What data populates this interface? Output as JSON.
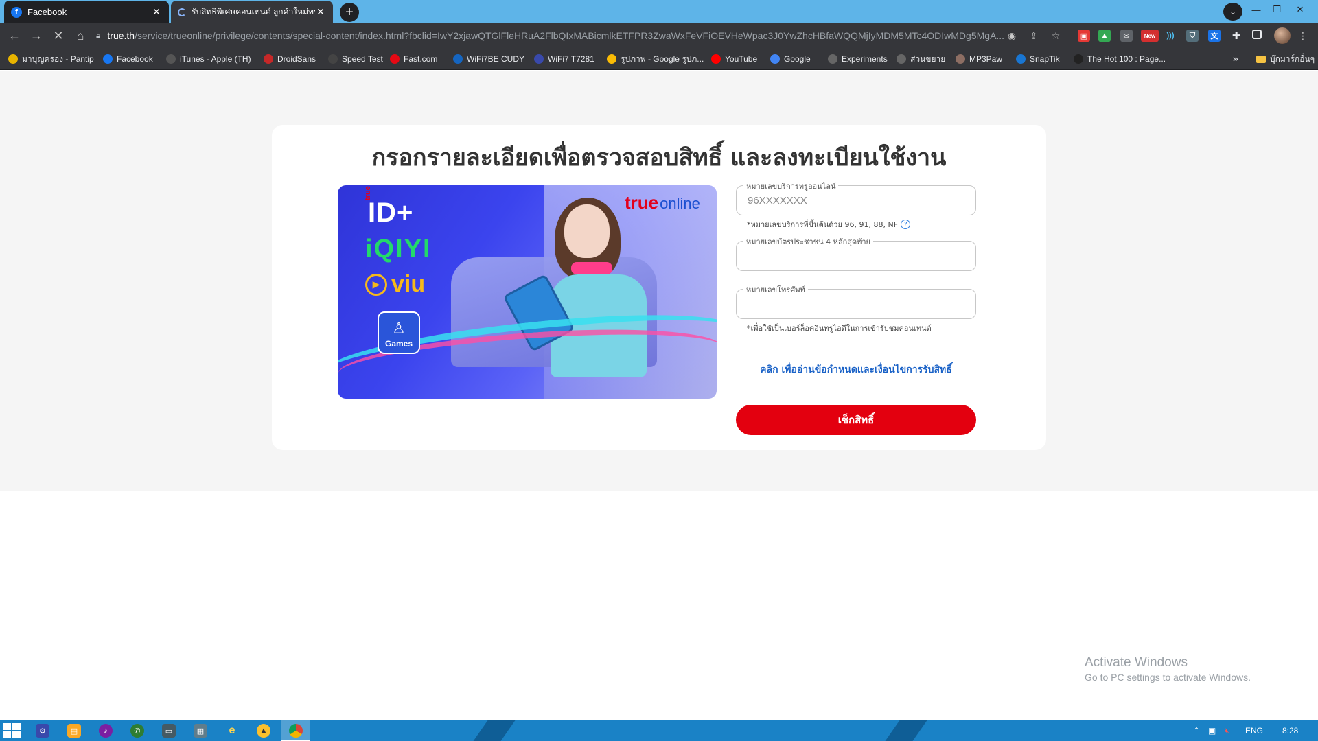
{
  "browser": {
    "tabs": [
      {
        "title": "Facebook",
        "favicon": "facebook-icon",
        "active": true
      },
      {
        "title": "รับสิทธิพิเศษคอนเทนต์ ลูกค้าใหม่ทรูออ",
        "favicon": "loading-icon",
        "active": false
      }
    ],
    "url_host": "true.th",
    "url_path": "/service/trueonline/privilege/contents/special-content/index.html?fbclid=IwY2xjawQTGlFleHRuA2FlbQIxMABicmlkETFPR3ZwaWxFeVFiOEVHeWpac3J0YwZhcHBfaWQQMjIyMDM5MTc4ODIwMDg5MgA...",
    "bookmarks": [
      {
        "label": "มาบุญครอง - Pantip",
        "icon": "pantip-icon",
        "color": "#e8b400"
      },
      {
        "label": "Facebook",
        "icon": "facebook-icon",
        "color": "#1877f2"
      },
      {
        "label": "iTunes - Apple (TH)",
        "icon": "apple-icon",
        "color": "#555555"
      },
      {
        "label": "DroidSans",
        "icon": "droidsans-icon",
        "color": "#c62828"
      },
      {
        "label": "Speed Test",
        "icon": "speedtest-icon",
        "color": "#444444"
      },
      {
        "label": "Fast.com",
        "icon": "fast-icon",
        "color": "#e50914"
      },
      {
        "label": "WiFi7BE CUDY",
        "icon": "cudy-icon",
        "color": "#1565c0"
      },
      {
        "label": "WiFi7 T7281",
        "icon": "wifi-icon",
        "color": "#3949ab"
      },
      {
        "label": "รูปภาพ - Google รูปภ...",
        "icon": "google-photos-icon",
        "color": "#fbbc05"
      },
      {
        "label": "YouTube",
        "icon": "youtube-icon",
        "color": "#ff0000"
      },
      {
        "label": "Google",
        "icon": "google-icon",
        "color": "#4285f4"
      },
      {
        "label": "Experiments",
        "icon": "experiments-icon",
        "color": "#666666"
      },
      {
        "label": "ส่วนขยาย",
        "icon": "puzzle-icon",
        "color": "#666666"
      },
      {
        "label": "MP3Paw",
        "icon": "paw-icon",
        "color": "#8d6e63"
      },
      {
        "label": "SnapTik",
        "icon": "download-icon",
        "color": "#1976d2"
      },
      {
        "label": "The Hot 100 : Page...",
        "icon": "billboard-icon",
        "color": "#222222"
      }
    ],
    "bookmarks_folder": "บุ๊กมาร์กอื่นๆ",
    "extension_badge": "New"
  },
  "page": {
    "title": "กรอกรายละเอียดเพื่อตรวจสอบสิทธิ์ และลงทะเบียนใช้งาน",
    "banner": {
      "logo_trueid": "ID+",
      "logo_true_small": "true",
      "logo_iqiyi": "iQIYI",
      "logo_viu": "viu",
      "logo_games": "Games",
      "brand_true": "true",
      "brand_online": "online"
    },
    "form": {
      "service_number": {
        "label": "หมายเลขบริการทรูออนไลน์",
        "placeholder": "96XXXXXXX",
        "hint": "*หมายเลขบริการที่ขึ้นต้นด้วย 96, 91, 88, NF"
      },
      "id_card": {
        "label": "หมายเลขบัตรประชาชน 4 หลักสุดท้าย",
        "placeholder": ""
      },
      "phone": {
        "label": "หมายเลขโทรศัพท์",
        "placeholder": "",
        "hint": "*เพื่อใช้เป็นเบอร์ล็อคอินทรูไอดีในการเข้ารับชมคอนเทนต์"
      },
      "terms_link": "คลิก เพื่ออ่านข้อกำหนดและเงื่อนไขการรับสิทธิ์",
      "submit": "เช็กสิทธิ์"
    }
  },
  "watermark": {
    "title": "Activate Windows",
    "subtitle": "Go to PC settings to activate Windows."
  },
  "taskbar": {
    "lang": "ENG",
    "time": "8:28"
  }
}
